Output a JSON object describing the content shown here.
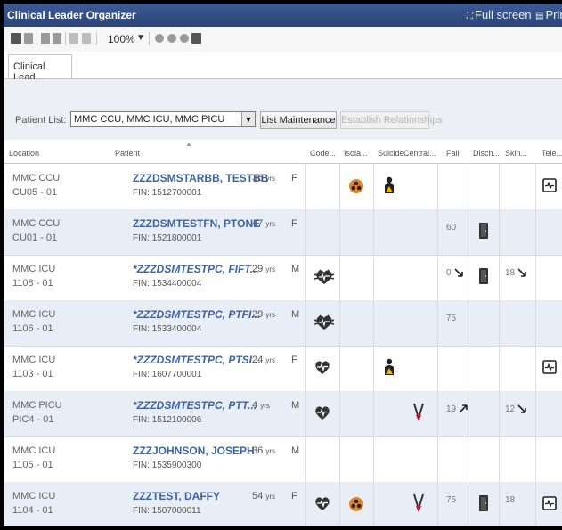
{
  "window": {
    "title": "Clinical Leader Organizer",
    "full_screen_label": "Full screen",
    "print_label": "Prin"
  },
  "toolbar": {
    "zoom": "100%"
  },
  "tabs": [
    {
      "label": "Clinical Lead..."
    }
  ],
  "filter": {
    "patient_list_label": "Patient List:",
    "patient_list_value": "MMC CCU, MMC ICU, MMC PICU",
    "list_maintenance_label": "List Maintenance",
    "establish_relationships_label": "Establish Relationships"
  },
  "columns": {
    "location": "Location",
    "patient": "Patient",
    "code": "Code...",
    "isolation": "Isola...",
    "suicide": "Suicide",
    "central": "Central...",
    "fall": "Fall",
    "discharge": "Disch...",
    "skin": "Skin...",
    "tele": "Tele..."
  },
  "icon_colors": {
    "code": "#333333",
    "isolation": "#e0832b",
    "suicide": "#f0b300",
    "fall_up": "#222222"
  },
  "rows": [
    {
      "unit": "MMC CCU",
      "room": "CU05 - 01",
      "name": "ZZZDSMSTARBB, TESTBB",
      "name_italic": false,
      "fin": "FIN: 1512700001",
      "age": "36",
      "age_unit": "yrs",
      "sex": "F",
      "code_icon": "",
      "isolation_icon": "biohazard-icon",
      "suicide_icon": "person-warning-icon",
      "central_line_icon": "",
      "fall": "",
      "fall_trend": "",
      "discharge_icon": "",
      "skin": "",
      "skin_trend": "",
      "tele_icon": "monitor-icon"
    },
    {
      "unit": "MMC CCU",
      "room": "CU01 - 01",
      "name": "ZZZDSMTESTFN, PTONE",
      "name_italic": false,
      "fin": "FIN: 1521800001",
      "age": "47",
      "age_unit": "yrs",
      "sex": "F",
      "code_icon": "",
      "isolation_icon": "",
      "suicide_icon": "",
      "central_line_icon": "",
      "fall": "60",
      "fall_trend": "",
      "discharge_icon": "door-icon",
      "skin": "",
      "skin_trend": "",
      "tele_icon": ""
    },
    {
      "unit": "MMC ICU",
      "room": "1108 - 01",
      "name": "*ZZZDSMTESTPC, FIFT...",
      "name_italic": true,
      "fin": "FIN: 1534400004",
      "age": "29",
      "age_unit": "yrs",
      "sex": "M",
      "code_icon": "dnr-heart-icon",
      "isolation_icon": "",
      "suicide_icon": "",
      "central_line_icon": "",
      "fall": "0",
      "fall_trend": "down",
      "discharge_icon": "door-icon",
      "skin": "18",
      "skin_trend": "down",
      "tele_icon": ""
    },
    {
      "unit": "MMC ICU",
      "room": "1106 - 01",
      "name": "*ZZZDSMTESTPC, PTFI...",
      "name_italic": true,
      "fin": "FIN: 1533400004",
      "age": "29",
      "age_unit": "yrs",
      "sex": "M",
      "code_icon": "dnr-heart-icon",
      "isolation_icon": "",
      "suicide_icon": "",
      "central_line_icon": "",
      "fall": "75",
      "fall_trend": "",
      "discharge_icon": "",
      "skin": "",
      "skin_trend": "",
      "tele_icon": ""
    },
    {
      "unit": "MMC ICU",
      "room": "1103 - 01",
      "name": "*ZZZDSMTESTPC, PTSI...",
      "name_italic": true,
      "fin": "FIN: 1607700001",
      "age": "24",
      "age_unit": "yrs",
      "sex": "F",
      "code_icon": "heart-icon",
      "isolation_icon": "",
      "suicide_icon": "person-warning-icon",
      "central_line_icon": "",
      "fall": "",
      "fall_trend": "",
      "discharge_icon": "",
      "skin": "",
      "skin_trend": "",
      "tele_icon": "monitor-icon"
    },
    {
      "unit": "MMC PICU",
      "room": "PIC4 - 01",
      "name": "*ZZZDSMTESTPC, PTT...",
      "name_italic": true,
      "fin": "FIN: 1512100006",
      "age": "4",
      "age_unit": "yrs",
      "sex": "M",
      "code_icon": "heart-icon",
      "isolation_icon": "",
      "suicide_icon": "",
      "central_line_icon": "central-line-icon",
      "fall": "19",
      "fall_trend": "up",
      "discharge_icon": "",
      "skin": "12",
      "skin_trend": "down",
      "tele_icon": ""
    },
    {
      "unit": "MMC ICU",
      "room": "1105 - 01",
      "name": "ZZZJOHNSON, JOSEPH",
      "name_italic": false,
      "fin": "FIN: 1535900300",
      "age": "36",
      "age_unit": "yrs",
      "sex": "M",
      "code_icon": "",
      "isolation_icon": "",
      "suicide_icon": "",
      "central_line_icon": "",
      "fall": "",
      "fall_trend": "",
      "discharge_icon": "",
      "skin": "",
      "skin_trend": "",
      "tele_icon": ""
    },
    {
      "unit": "MMC ICU",
      "room": "1104 - 01",
      "name": "ZZZTEST, DAFFY",
      "name_italic": false,
      "fin": "FIN: 1507000011",
      "age": "54",
      "age_unit": "yrs",
      "sex": "F",
      "code_icon": "heart-icon",
      "isolation_icon": "biohazard-icon",
      "suicide_icon": "",
      "central_line_icon": "central-line-icon",
      "fall": "75",
      "fall_trend": "",
      "discharge_icon": "door-icon",
      "skin": "18",
      "skin_trend": "",
      "tele_icon": "monitor-icon"
    }
  ]
}
